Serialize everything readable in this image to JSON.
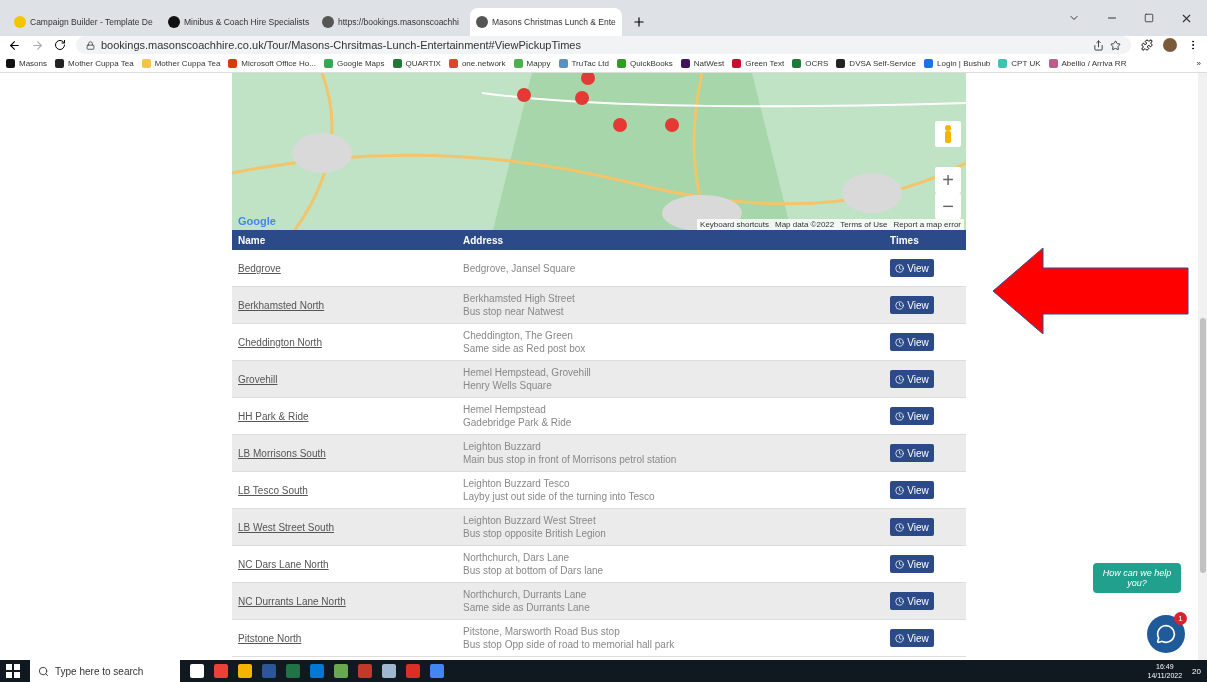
{
  "browser": {
    "tabs": [
      {
        "title": "Campaign Builder - Template De",
        "selected": false,
        "color": "#f5c400"
      },
      {
        "title": "Minibus & Coach Hire Specialists",
        "selected": false,
        "color": "#111111"
      },
      {
        "title": "https://bookings.masonscoachhi",
        "selected": false,
        "color": "#555555"
      },
      {
        "title": "Masons Christmas Lunch & Ente",
        "selected": true,
        "color": "#555555"
      }
    ],
    "url": "bookings.masonscoachhire.co.uk/Tour/Masons-Chrsitmas-Lunch-Entertainment#ViewPickupTimes",
    "bookmarks": [
      {
        "label": "Masons",
        "color": "#111111"
      },
      {
        "label": "Mother Cuppa Tea",
        "color": "#222222"
      },
      {
        "label": "Mother Cuppa Tea",
        "color": "#f4c542"
      },
      {
        "label": "Microsoft Office Ho...",
        "color": "#d83b01"
      },
      {
        "label": "Google Maps",
        "color": "#34a853"
      },
      {
        "label": "QUARTIX",
        "color": "#1e7a34"
      },
      {
        "label": "one.network",
        "color": "#e0452b"
      },
      {
        "label": "Mappy",
        "color": "#4caf50"
      },
      {
        "label": "TruTac Ltd",
        "color": "#5b8fc7"
      },
      {
        "label": "QuickBooks",
        "color": "#2ca01c"
      },
      {
        "label": "NatWest",
        "color": "#42145f"
      },
      {
        "label": "Green Text",
        "color": "#c8102e"
      },
      {
        "label": "OCRS",
        "color": "#1a7a3a"
      },
      {
        "label": "DVSA Self-Service",
        "color": "#222222"
      },
      {
        "label": "Login | Bushub",
        "color": "#1a73e8"
      },
      {
        "label": "CPT UK",
        "color": "#3cc5b0"
      },
      {
        "label": "Abellio / Arriva RR",
        "color": "#c05a8a"
      }
    ],
    "more": "»"
  },
  "map": {
    "kind": "picture",
    "logo": "Google",
    "attribution": [
      "Keyboard shortcuts",
      "Map data ©2022",
      "Terms of Use",
      "Report a map error"
    ],
    "zoom_in": "+",
    "zoom_out": "−"
  },
  "table": {
    "columns": [
      "Name",
      "Address",
      "Times"
    ],
    "rows": [
      {
        "name": "Bedgrove",
        "address": [
          "Bedgrove, Jansel Square"
        ],
        "button": "View"
      },
      {
        "name": "Berkhamsted North",
        "address": [
          "Berkhamsted High Street",
          "Bus stop near Natwest"
        ],
        "button": "View"
      },
      {
        "name": "Cheddington North",
        "address": [
          "Cheddington, The Green",
          "Same side as Red post box"
        ],
        "button": "View"
      },
      {
        "name": "Grovehill",
        "address": [
          "Hemel Hempstead, Grovehill",
          "Henry Wells Square"
        ],
        "button": "View"
      },
      {
        "name": "HH Park & Ride",
        "address": [
          "Hemel Hempstead",
          "Gadebridge Park & Ride"
        ],
        "button": "View"
      },
      {
        "name": "LB Morrisons South",
        "address": [
          "Leighton Buzzard",
          "Main bus stop in front of Morrisons petrol station"
        ],
        "button": "View"
      },
      {
        "name": "LB Tesco South",
        "address": [
          "Leighton Buzzard Tesco",
          "Layby just out side of the turning into Tesco"
        ],
        "button": "View"
      },
      {
        "name": "LB West Street South",
        "address": [
          "Leighton Buzzard West Street",
          "Bus stop opposite British Legion"
        ],
        "button": "View"
      },
      {
        "name": "NC Dars Lane North",
        "address": [
          "Northchurch, Dars Lane",
          "Bus stop at bottom of Dars lane"
        ],
        "button": "View"
      },
      {
        "name": "NC Durrants Lane North",
        "address": [
          "Northchurch, Durrants Lane",
          "Same side as Durrants Lane"
        ],
        "button": "View"
      },
      {
        "name": "Pitstone North",
        "address": [
          "Pitstone, Marsworth Road Bus stop",
          "Bus stop Opp side of road to memorial hall park"
        ],
        "button": "View"
      }
    ]
  },
  "chat": {
    "bubble": "How can we help you?",
    "badge": "1"
  },
  "taskbar": {
    "search_placeholder": "Type here to search",
    "time": "16:49",
    "date": "14/11/2022",
    "notifications": "20"
  }
}
